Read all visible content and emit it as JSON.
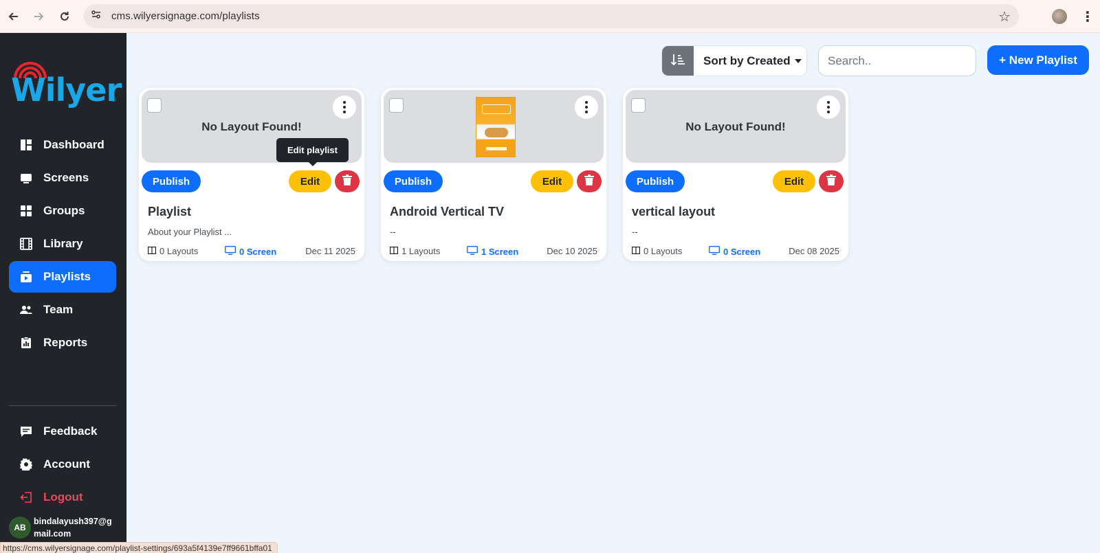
{
  "browser": {
    "url": "cms.wilyersignage.com/playlists",
    "status_url": "https://cms.wilyersignage.com/playlist-settings/693a5f4139e7ff9661bffa01"
  },
  "brand": {
    "logo_text": "Wilyer",
    "logo_mark": "®",
    "primary_color": "#0d6efd",
    "logo_color": "#1aa7e8",
    "logo_arc_color": "#e8252e"
  },
  "sidebar": {
    "items": [
      {
        "label": "Dashboard",
        "icon": "dashboard-icon"
      },
      {
        "label": "Screens",
        "icon": "monitor-icon"
      },
      {
        "label": "Groups",
        "icon": "grid-icon"
      },
      {
        "label": "Library",
        "icon": "film-icon"
      },
      {
        "label": "Playlists",
        "icon": "playlist-icon",
        "active": true
      },
      {
        "label": "Team",
        "icon": "team-icon"
      },
      {
        "label": "Reports",
        "icon": "clipboard-icon"
      }
    ],
    "secondary_items": [
      {
        "label": "Feedback",
        "icon": "feedback-icon"
      },
      {
        "label": "Account",
        "icon": "gear-icon"
      },
      {
        "label": "Logout",
        "icon": "logout-icon"
      }
    ],
    "user": {
      "initials": "AB",
      "email": "bindalayush397@gmail.com"
    }
  },
  "toolbar": {
    "sort_label": "Sort by Created",
    "search_placeholder": "Search..",
    "new_button": "+ New Playlist"
  },
  "cards": [
    {
      "preview_text": "No Layout Found!",
      "has_thumbnail": false,
      "publish": "Publish",
      "edit": "Edit",
      "title": "Playlist",
      "description": "About your Playlist ...",
      "layouts": "0 Layouts",
      "screens": "0 Screen",
      "date": "Dec 11 2025"
    },
    {
      "preview_text": "",
      "has_thumbnail": true,
      "publish": "Publish",
      "edit": "Edit",
      "title": "Android Vertical TV",
      "description": "--",
      "layouts": "1 Layouts",
      "screens": "1 Screen",
      "date": "Dec 10 2025"
    },
    {
      "preview_text": "No Layout Found!",
      "has_thumbnail": false,
      "publish": "Publish",
      "edit": "Edit",
      "title": "vertical layout",
      "description": "--",
      "layouts": "0 Layouts",
      "screens": "0 Screen",
      "date": "Dec 08 2025"
    }
  ],
  "tooltip": {
    "text": "Edit playlist"
  }
}
